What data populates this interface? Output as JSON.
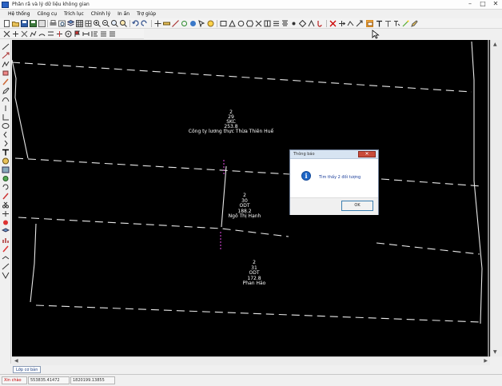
{
  "window": {
    "title": "Phân rã và lý dữ liệu không gian",
    "min": "–",
    "max": "□",
    "close": "✕"
  },
  "menu": [
    {
      "label": "Hệ thống"
    },
    {
      "label": "Công cụ"
    },
    {
      "label": "Trích lục"
    },
    {
      "label": "Chỉnh lý"
    },
    {
      "label": "In ấn"
    },
    {
      "label": "Trợ giúp"
    }
  ],
  "parcels": [
    {
      "sheet": "2",
      "number": "29",
      "use": "SKC",
      "area": "253.8",
      "owner": "Công ty lương thực Thừa Thiên Huế"
    },
    {
      "sheet": "2",
      "number": "30",
      "use": "ODT",
      "area": "188.2",
      "owner": "Ngô Thị Hạnh"
    },
    {
      "sheet": "2",
      "number": "31",
      "use": "ODT",
      "area": "172.8",
      "owner": "Phan Hảo"
    }
  ],
  "dialog": {
    "title": "Thông báo",
    "message": "Tìm thấy 2 đối tượng",
    "ok_label": "OK",
    "close": "✕",
    "icon": "info-icon"
  },
  "layer_tab": "Lớp cơ bản",
  "status": {
    "mode": "Xin chào",
    "x": "553835.41472",
    "y": "1820199.13855"
  }
}
